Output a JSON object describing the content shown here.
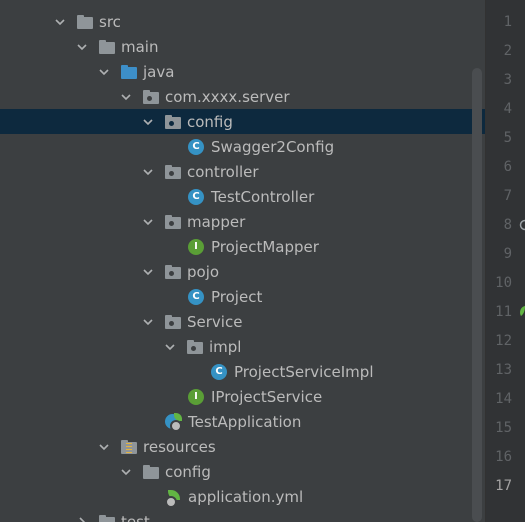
{
  "tree": {
    "items": [
      {
        "label": "src",
        "icon": "folder-icon"
      },
      {
        "label": "main",
        "icon": "folder-icon"
      },
      {
        "label": "java",
        "icon": "source-folder-icon"
      },
      {
        "label": "com.xxxx.server",
        "icon": "package-icon"
      },
      {
        "label": "config",
        "icon": "package-icon",
        "selected": true
      },
      {
        "label": "Swagger2Config",
        "icon": "class-icon"
      },
      {
        "label": "controller",
        "icon": "package-icon"
      },
      {
        "label": "TestController",
        "icon": "class-icon"
      },
      {
        "label": "mapper",
        "icon": "package-icon"
      },
      {
        "label": "ProjectMapper",
        "icon": "interface-icon"
      },
      {
        "label": "pojo",
        "icon": "package-icon"
      },
      {
        "label": "Project",
        "icon": "class-icon"
      },
      {
        "label": "Service",
        "icon": "package-icon"
      },
      {
        "label": "impl",
        "icon": "package-icon"
      },
      {
        "label": "ProjectServiceImpl",
        "icon": "class-icon"
      },
      {
        "label": "IProjectService",
        "icon": "interface-icon"
      },
      {
        "label": "TestApplication",
        "icon": "spring-boot-app-icon"
      },
      {
        "label": "resources",
        "icon": "resources-folder-icon"
      },
      {
        "label": "config",
        "icon": "folder-icon"
      },
      {
        "label": "application.yml",
        "icon": "spring-yml-icon"
      },
      {
        "label": "test",
        "icon": "folder-icon"
      }
    ]
  },
  "gutter": {
    "line_numbers": [
      "1",
      "2",
      "3",
      "4",
      "5",
      "6",
      "7",
      "8",
      "9",
      "10",
      "11",
      "12",
      "13",
      "14",
      "15",
      "16",
      "17"
    ],
    "current_line": "17"
  },
  "colors": {
    "tree_background": "#3c3f41",
    "selection": "#0d293e",
    "text": "#bbbbbb",
    "gutter_background": "#313335",
    "class_icon": "#3592c4",
    "interface_icon": "#5a9e36"
  }
}
